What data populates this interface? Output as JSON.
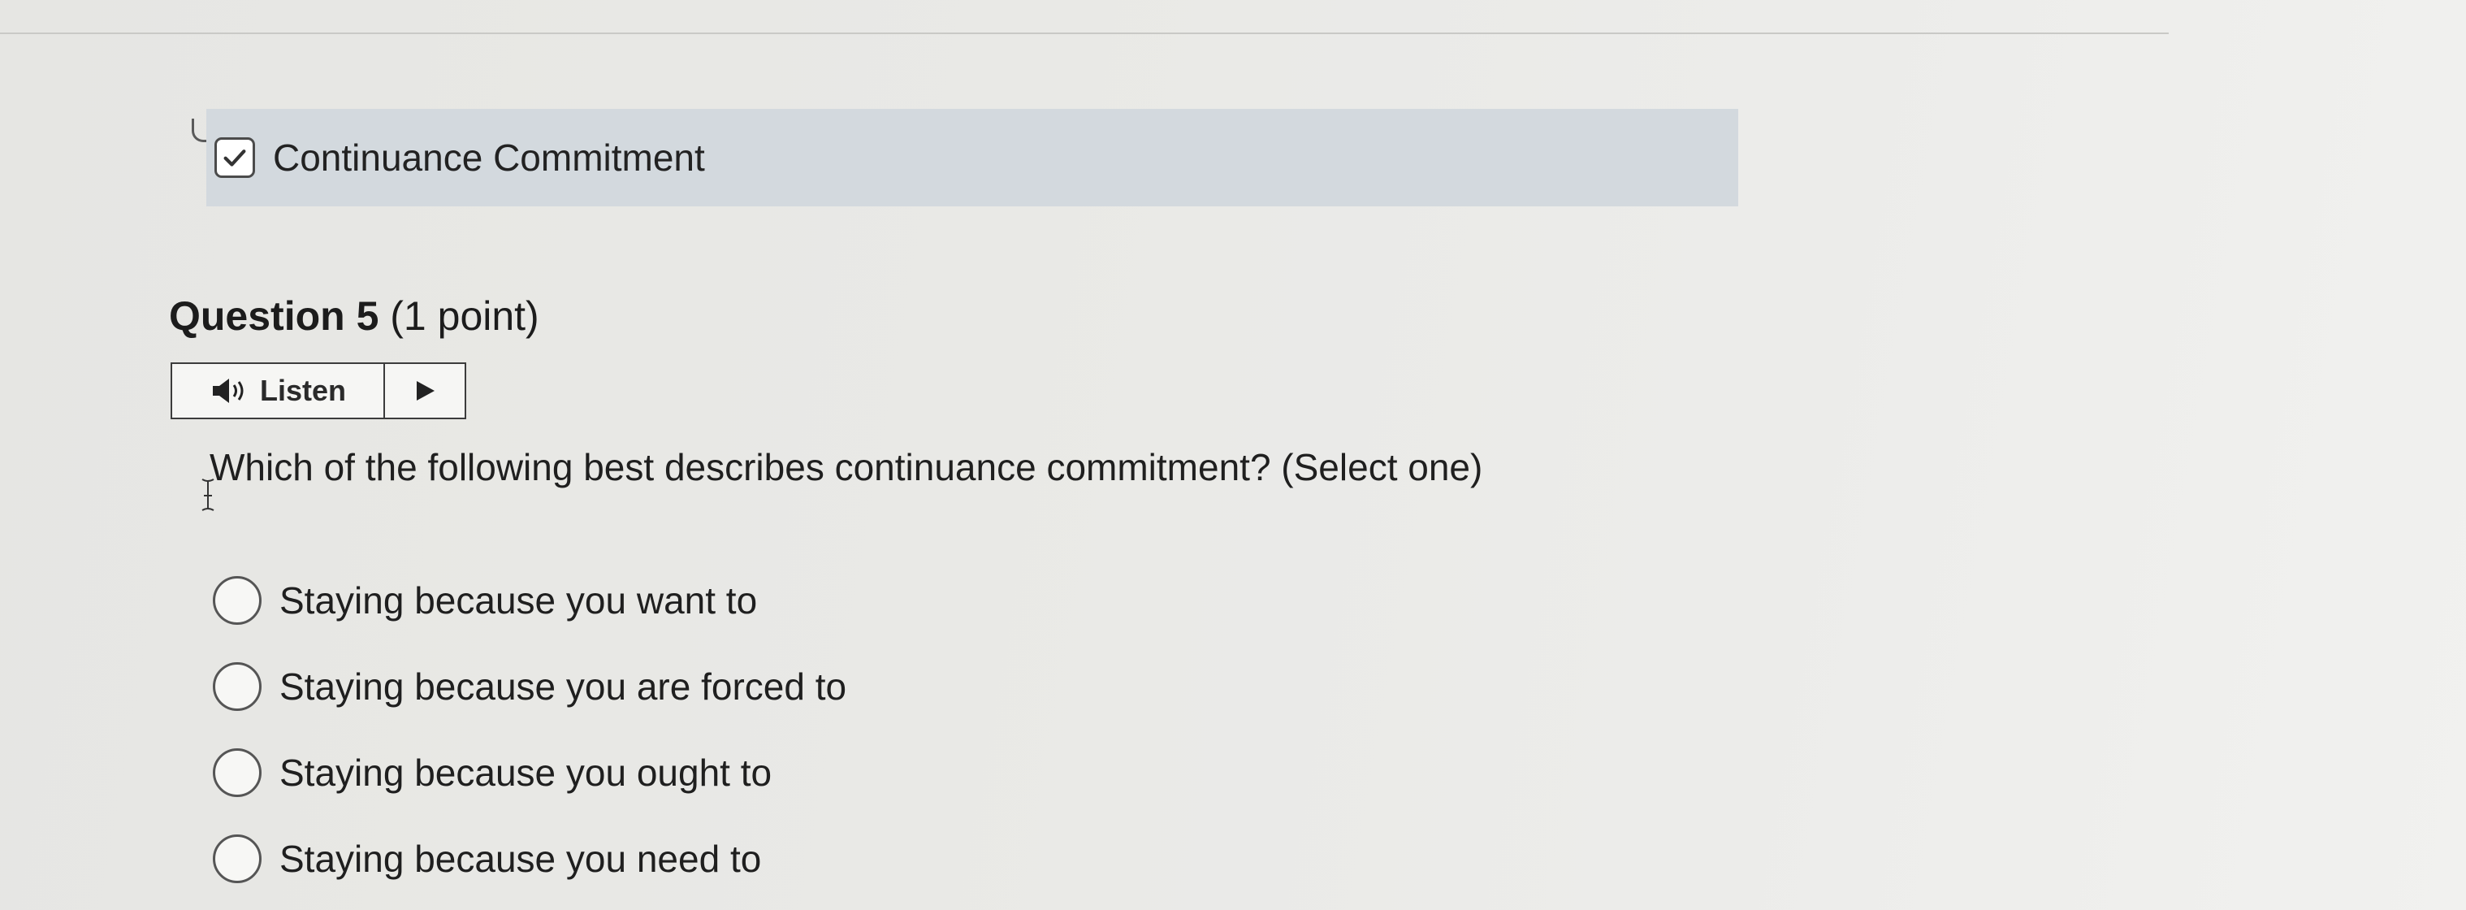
{
  "previous_answer": {
    "checked": true,
    "label": "Continuance Commitment",
    "highlight_color": "#d3d9de"
  },
  "question": {
    "title": "Question 5",
    "points": "(1 point)",
    "prompt": "Which of the following best describes continuance commitment? (Select one)"
  },
  "listen": {
    "label": "Listen",
    "speaker_icon": "speaker-icon",
    "play_icon": "play-icon"
  },
  "options": [
    {
      "label": "Staying because you want to",
      "selected": false
    },
    {
      "label": "Staying because you are forced to",
      "selected": false
    },
    {
      "label": "Staying because you ought to",
      "selected": false
    },
    {
      "label": "Staying because you need to",
      "selected": false
    }
  ]
}
